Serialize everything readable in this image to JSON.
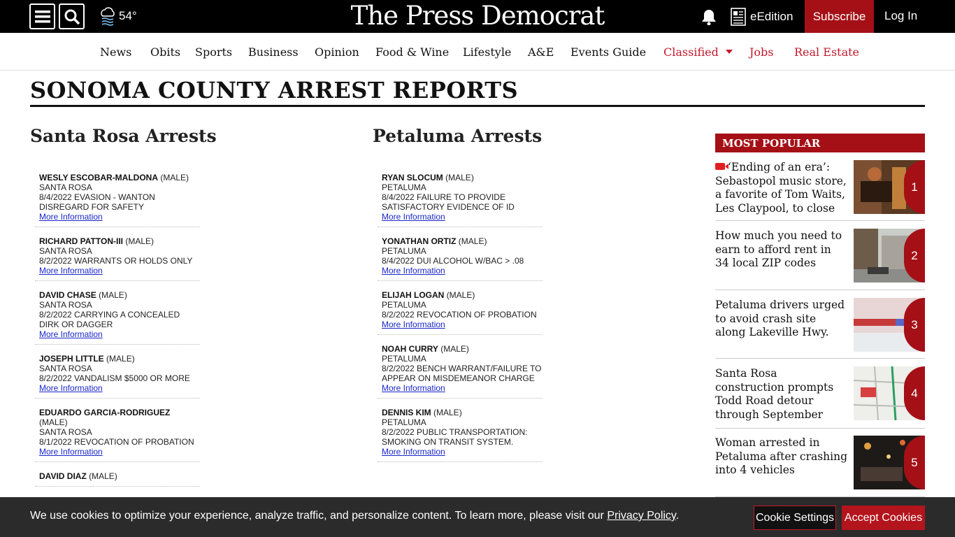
{
  "header": {
    "temperature": "54°",
    "logo": "The Press Democrat",
    "edition_label": "eEdition",
    "subscribe_label": "Subscribe",
    "login_label": "Log In"
  },
  "nav": {
    "items": [
      "News",
      "Obits",
      "Sports",
      "Business",
      "Opinion",
      "Food & Wine",
      "Lifestyle",
      "A&E",
      "Events Guide",
      "Classified",
      "Jobs",
      "Real Estate"
    ]
  },
  "page": {
    "title": "SONOMA COUNTY ARREST REPORTS",
    "santa_rosa_heading": "Santa Rosa Arrests",
    "petaluma_heading": "Petaluma Arrests"
  },
  "santa_rosa": [
    {
      "name": "WESLY ESCOBAR-MALDONA",
      "gender": "(MALE)",
      "city": "SANTA ROSA",
      "charge": "8/4/2022 EVASION - WANTON DISREGARD FOR SAFETY",
      "link": "More Information"
    },
    {
      "name": "RICHARD PATTON-III",
      "gender": "(MALE)",
      "city": "SANTA ROSA",
      "charge": "8/2/2022 WARRANTS OR HOLDS ONLY",
      "link": "More Information"
    },
    {
      "name": "DAVID CHASE",
      "gender": "(MALE)",
      "city": "SANTA ROSA",
      "charge": "8/2/2022 CARRYING A CONCEALED DIRK OR DAGGER",
      "link": "More Information"
    },
    {
      "name": "JOSEPH LITTLE",
      "gender": "(MALE)",
      "city": "SANTA ROSA",
      "charge": "8/2/2022 VANDALISM $5000 OR MORE",
      "link": "More Information"
    },
    {
      "name": "EDUARDO GARCIA-RODRIGUEZ",
      "gender": "(MALE)",
      "city": "SANTA ROSA",
      "charge": "8/1/2022 REVOCATION OF PROBATION",
      "link": "More Information"
    },
    {
      "name": "DAVID DIAZ",
      "gender": "(MALE)",
      "city": "",
      "charge": "",
      "link": ""
    }
  ],
  "petaluma": [
    {
      "name": "RYAN SLOCUM",
      "gender": "(MALE)",
      "city": "PETALUMA",
      "charge": "8/4/2022 FAILURE TO PROVIDE SATISFACTORY EVIDENCE OF ID",
      "link": "More Information"
    },
    {
      "name": "YONATHAN ORTIZ",
      "gender": "(MALE)",
      "city": "PETALUMA",
      "charge": "8/4/2022 DUI ALCOHOL W/BAC > .08",
      "link": "More Information"
    },
    {
      "name": "ELIJAH LOGAN",
      "gender": "(MALE)",
      "city": "PETALUMA",
      "charge": "8/2/2022 REVOCATION OF PROBATION",
      "link": "More Information"
    },
    {
      "name": "NOAH CURRY",
      "gender": "(MALE)",
      "city": "PETALUMA",
      "charge": "8/2/2022 BENCH WARRANT/FAILURE TO APPEAR ON MISDEMEANOR CHARGE",
      "link": "More Information"
    },
    {
      "name": "DENNIS KIM",
      "gender": "(MALE)",
      "city": "PETALUMA",
      "charge": "8/2/2022 PUBLIC TRANSPORTATION: SMOKING ON TRANSIT SYSTEM.",
      "link": "More Information"
    }
  ],
  "most_popular": {
    "heading": "MOST POPULAR",
    "items": [
      {
        "rank": "1",
        "title": "‘Ending of an era’: Sebastopol music store, a favorite of Tom Waits, Les Claypool, to close",
        "video": true
      },
      {
        "rank": "2",
        "title": "How much you need to earn to afford rent in 34 local ZIP codes",
        "video": false
      },
      {
        "rank": "3",
        "title": "Petaluma drivers urged to avoid crash site along Lakeville Hwy.",
        "video": false
      },
      {
        "rank": "4",
        "title": "Santa Rosa construction prompts Todd Road detour through September",
        "video": false
      },
      {
        "rank": "5",
        "title": "Woman arrested in Petaluma after crashing into 4 vehicles",
        "video": false
      }
    ]
  },
  "cookie": {
    "text": "We use cookies to optimize your experience, analyze traffic, and personalize content. To learn more, please visit our",
    "link": "Privacy Policy",
    "suffix": ".",
    "settings_label": "Cookie Settings",
    "accept_label": "Accept Cookies"
  }
}
